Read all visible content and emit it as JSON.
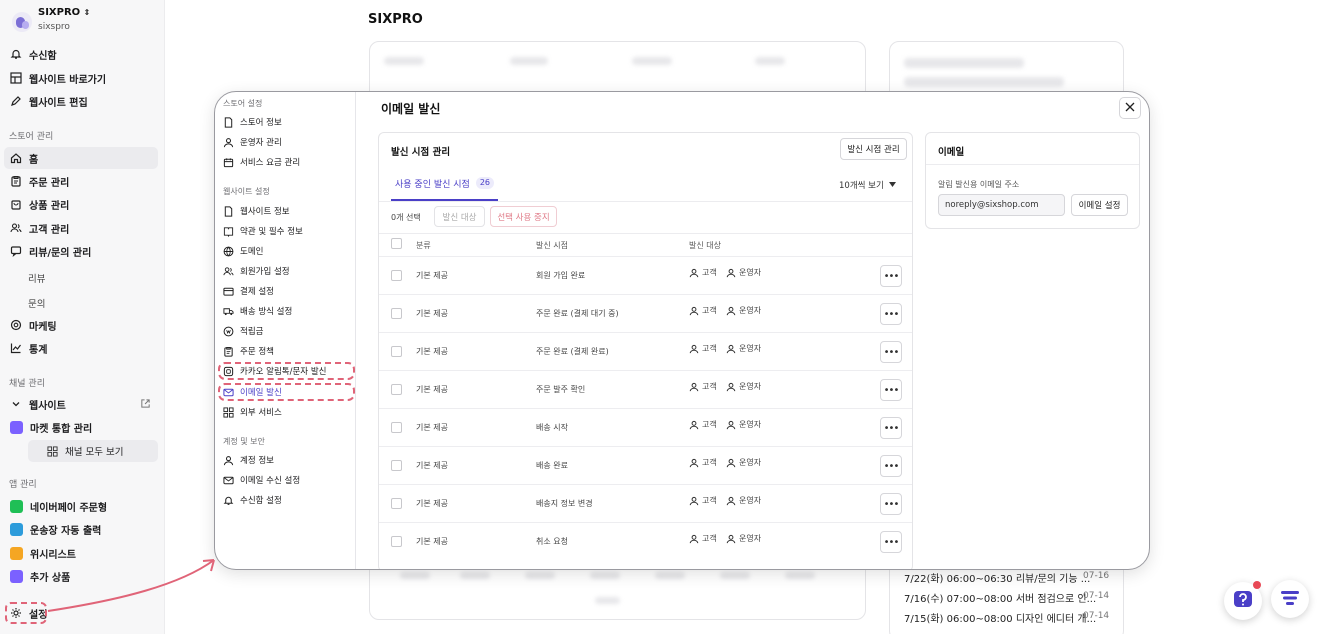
{
  "brand": {
    "name": "SIXPRO",
    "sub": "sixspro"
  },
  "sidebar": {
    "top_items": [
      {
        "label": "수신함",
        "icon": "bell-icon"
      },
      {
        "label": "웹사이트 바로가기",
        "icon": "grid-icon"
      },
      {
        "label": "웹사이트 편집",
        "icon": "pencil-icon"
      }
    ],
    "store_section": "스토어 관리",
    "store_items": [
      {
        "label": "홈",
        "icon": "home-icon"
      },
      {
        "label": "주문 관리",
        "icon": "clipboard-icon"
      },
      {
        "label": "상품 관리",
        "icon": "bag-icon"
      },
      {
        "label": "고객 관리",
        "icon": "users-icon"
      },
      {
        "label": "리뷰/문의 관리",
        "icon": "chat-icon"
      }
    ],
    "review_subs": [
      "리뷰",
      "문의"
    ],
    "marketing": "마케팅",
    "stats": "통계",
    "channel_section": "채널 관리",
    "website": "웹사이트",
    "market": "마켓 통합 관리",
    "all_channels": "채널 모두 보기",
    "app_section": "앱 관리",
    "apps": [
      {
        "label": "네이버페이 주문형",
        "color": "#1fbf56"
      },
      {
        "label": "운송장 자동 출력",
        "color": "#2d9cdb"
      },
      {
        "label": "위시리스트",
        "color": "#f5a623"
      },
      {
        "label": "추가 상품",
        "color": "#7b61ff"
      }
    ],
    "settings": "설정"
  },
  "page": {
    "title": "SIXPRO"
  },
  "notices": [
    {
      "text": "7/22(화) 06:00~06:30 리뷰/문의 기능 ...",
      "date": "07-16"
    },
    {
      "text": "7/16(수) 07:00~08:00 서버 점검으로 인...",
      "date": "07-14"
    },
    {
      "text": "7/15(화) 06:00~08:00 디자인 에디터 개...",
      "date": "07-14"
    }
  ],
  "modal": {
    "title": "이메일 발신",
    "side_sections": {
      "store": "스토어 설정",
      "website": "웹사이트 설정",
      "account": "계정 및 보안"
    },
    "store_items": [
      "스토어 정보",
      "운영자 관리",
      "서비스 요금 관리"
    ],
    "website_items": [
      "웹사이트 정보",
      "약관 및 필수 정보",
      "도메인",
      "회원가입 설정",
      "결제 설정",
      "배송 방식 설정",
      "적립금",
      "주문 정책",
      "카카오 알림톡/문자 발신",
      "이메일 발신",
      "외부 서비스"
    ],
    "account_items": [
      "계정 정보",
      "이메일 수신 설정",
      "수신함 설정"
    ],
    "panel": {
      "title": "발신 시점 관리",
      "manage_button": "발신 시점 관리",
      "tab_label": "사용 중인 발신 시점",
      "tab_count": "26",
      "per_page": "10개씩 보기",
      "selected_count": "0개 선택",
      "target_button": "발신 대상",
      "stop_button": "선택 사용 중지",
      "headers": {
        "category": "분류",
        "timing": "발신 시점",
        "target": "발신 대상"
      },
      "target_customer": "고객",
      "target_operator": "운영자",
      "rows": [
        {
          "category": "기본 제공",
          "timing": "회원 가입 완료"
        },
        {
          "category": "기본 제공",
          "timing": "주문 완료 (결제 대기 중)"
        },
        {
          "category": "기본 제공",
          "timing": "주문 완료 (결제 완료)"
        },
        {
          "category": "기본 제공",
          "timing": "주문 발주 확인"
        },
        {
          "category": "기본 제공",
          "timing": "배송 시작"
        },
        {
          "category": "기본 제공",
          "timing": "배송 완료"
        },
        {
          "category": "기본 제공",
          "timing": "배송지 정보 변경"
        },
        {
          "category": "기본 제공",
          "timing": "취소 요청"
        }
      ]
    },
    "email": {
      "title": "이메일",
      "label": "알림 발신용 이메일 주소",
      "address": "noreply@sixshop.com",
      "button": "이메일 설정"
    }
  },
  "colors": {
    "accent": "#4a3fc7",
    "highlight": "#e06478"
  }
}
